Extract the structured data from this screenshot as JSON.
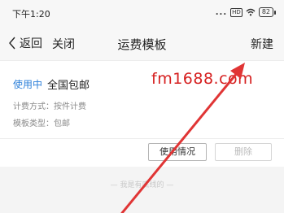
{
  "status_bar": {
    "time": "下午1:20",
    "signal": "...",
    "hd_badge": "HD",
    "battery": "82"
  },
  "nav": {
    "back_label": "返回",
    "close_label": "关闭",
    "title": "运费模板",
    "new_label": "新建"
  },
  "template": {
    "status_tag": "使用中",
    "name": "全国包邮",
    "billing_method": "计费方式：按件计费",
    "template_type": "模板类型：包邮",
    "usage_button": "使用情况",
    "delete_button": "删除"
  },
  "footer": {
    "bottom_line": "— 我是有底线的 —"
  },
  "watermark": "fm1688.com",
  "colors": {
    "accent_blue": "#2b7fd9",
    "annotation_red": "#e03535"
  }
}
